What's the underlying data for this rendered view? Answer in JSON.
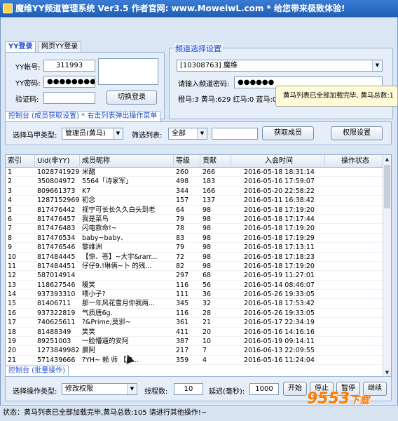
{
  "window": {
    "title": "魔维YY频道管理系统 Ver3.5   作者官网: www.MoweiwL.com   *  给您带来极致体验!"
  },
  "login": {
    "tabs": [
      "YY登录",
      "网页YY登录"
    ],
    "account_label": "YY帐号:",
    "account_value": "311993",
    "password_label": "YY密码:",
    "password_value": "●●●●●●●●",
    "captcha_label": "验证码:",
    "captcha_value": "",
    "switch_button": "切换登录"
  },
  "channel": {
    "title": "频道选择设置",
    "selected_channel": "[10308763] 魔维",
    "password_label": "请输入频道密码:",
    "password_value": "●●●●●●",
    "stats": "橙马:3   黄马:629   红马:0   蓝马:0   绿马:5"
  },
  "control": {
    "tab_label": "控制台 (成员获取设置) * 右击列表弹出操作菜单",
    "type_label": "选择马甲类型:",
    "type_value": "管理员(黄马)",
    "filter_label": "筛选列表:",
    "filter_value": "全部",
    "filter_input": "",
    "fetch_button": "获取成员",
    "permission_button": "权限设置"
  },
  "tooltip": {
    "text": "黄马列表已全部加载完毕, 黄马总数:1"
  },
  "table": {
    "columns": [
      "索引",
      "Uid(非YY)",
      "成员昵称",
      "等级",
      "贡献",
      "入会时间",
      "操作状态"
    ],
    "rows": [
      [
        "1",
        "1028741929",
        "米醋",
        "260",
        "266",
        "2016-05-18  18:31:14",
        ""
      ],
      [
        "2",
        "350804972",
        "5564「诗家军」",
        "498",
        "183",
        "2016-05-16  17:59:07",
        ""
      ],
      [
        "3",
        "809661373",
        "K7",
        "344",
        "166",
        "2016-05-20  22:58:22",
        ""
      ],
      [
        "4",
        "1287152969",
        "初念",
        "157",
        "137",
        "2016-05-11  16:38:42",
        ""
      ],
      [
        "5",
        "817476442",
        "视宁可长长久久白头到老",
        "64",
        "98",
        "2016-05-18  17:19:20",
        ""
      ],
      [
        "6",
        "817476457",
        "我是菜鸟",
        "79",
        "98",
        "2016-05-18  17:17:44",
        ""
      ],
      [
        "7",
        "817476483",
        "闪电救命!~",
        "78",
        "98",
        "2016-05-18  17:19:20",
        ""
      ],
      [
        "8",
        "817476534",
        "baby~baby、",
        "83",
        "98",
        "2016-05-18  17:19:29",
        ""
      ],
      [
        "9",
        "817476546",
        "黎维洲",
        "79",
        "98",
        "2016-05-18  17:13:11",
        ""
      ],
      [
        "10",
        "817484445",
        "【惊、苍】~大宇&rarr...",
        "72",
        "98",
        "2016-05-18  17:18:23",
        ""
      ],
      [
        "11",
        "817484451",
        "仔仔9.!琳俩~卜 的残...",
        "82",
        "98",
        "2016-05-18  17:19:20",
        ""
      ],
      [
        "12",
        "587014914",
        "",
        "297",
        "68",
        "2016-05-19  11:27:01",
        ""
      ],
      [
        "13",
        "118627546",
        "暖笑",
        "116",
        "56",
        "2016-05-14  08:46:07",
        ""
      ],
      [
        "14",
        "937393310",
        "喂小子?",
        "111",
        "36",
        "2016-05-26  19:33:05",
        ""
      ],
      [
        "15",
        "81406711",
        "那一年风花雪月你我两...",
        "345",
        "32",
        "2016-05-18  17:53:42",
        ""
      ],
      [
        "16",
        "937322819",
        "气质唐6g.",
        "116",
        "28",
        "2016-05-26  19:33:05",
        ""
      ],
      [
        "17",
        "740625611",
        "?&Prime;莫邪~",
        "361",
        "21",
        "2016-05-17  22:34:19",
        ""
      ],
      [
        "18",
        "81488349",
        "笑笑",
        "411",
        "20",
        "2016-05-16  14:16:16",
        ""
      ],
      [
        "19",
        "89251003",
        "一脸懵逼的安阿",
        "387",
        "10",
        "2016-05-19  09:14:11",
        ""
      ],
      [
        "20",
        "1273849982",
        "晨阿",
        "217",
        "7",
        "2016-06-13  22:09:55",
        ""
      ],
      [
        "21",
        "571439666",
        "?YH~ 赖  师 【M...",
        "359",
        "4",
        "2016-05-16  11:24:04",
        ""
      ]
    ]
  },
  "batch": {
    "tab_label": "控制台 (批量操作)",
    "type_label": "选择操作类型:",
    "type_value": "修改权限",
    "threads_label": "线程数:",
    "threads_value": "10",
    "delay_label": "延迟(毫秒):",
    "delay_value": "1000",
    "start": "开始",
    "stop": "停止",
    "pause": "暂停",
    "resume": "继续"
  },
  "status": {
    "text": "状态：黄马列表已全部加载完毕,黄马总数:105 请进行其他操作!~"
  },
  "watermark": {
    "main": "9553",
    "sub": "下载"
  }
}
